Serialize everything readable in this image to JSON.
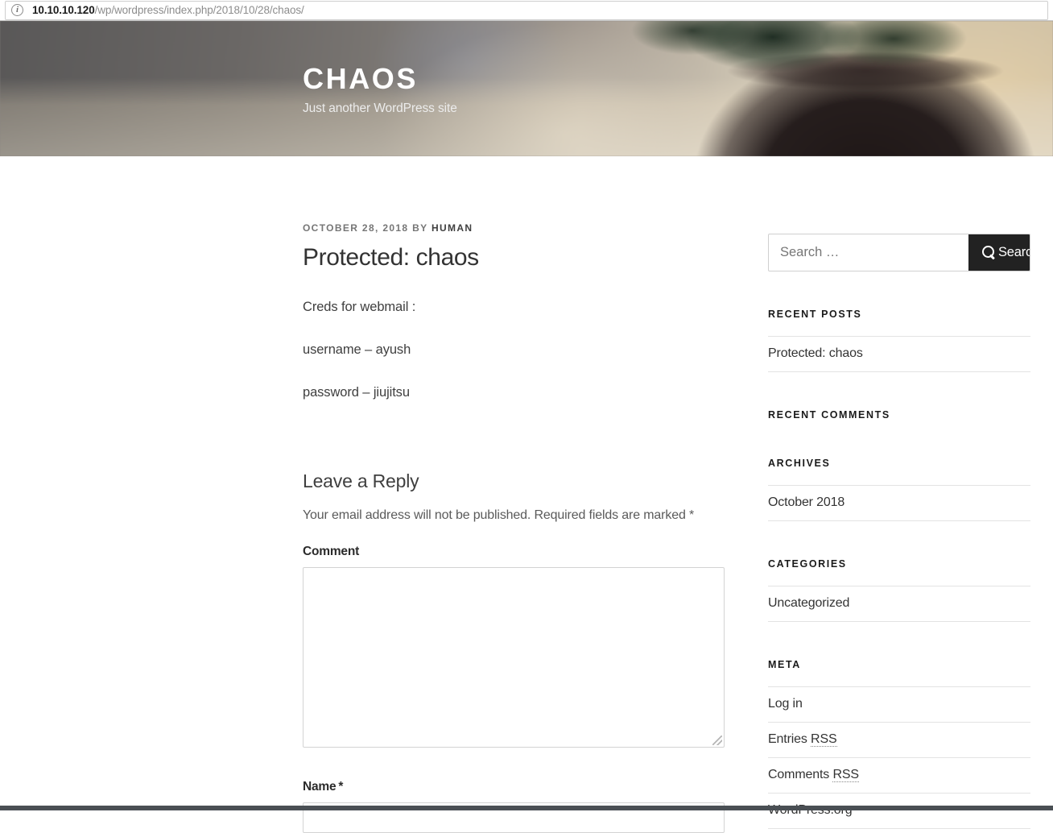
{
  "browser": {
    "info_icon": "info-circle-icon",
    "url_host": "10.10.10.120",
    "url_path": "/wp/wordpress/index.php/2018/10/28/chaos/"
  },
  "header": {
    "site_title": "CHAOS",
    "tagline": "Just another WordPress site"
  },
  "post": {
    "meta_date": "OCTOBER 28, 2018",
    "meta_by": "BY",
    "meta_author": "HUMAN",
    "title": "Protected: chaos",
    "paragraphs": [
      "Creds for webmail :",
      "username – ayush",
      "password – jiujitsu"
    ]
  },
  "comments": {
    "title": "Leave a Reply",
    "notes": "Your email address will not be published. Required fields are marked *",
    "comment_label": "Comment",
    "comment_value": "",
    "name_label": "Name",
    "name_required_mark": "*",
    "name_value": ""
  },
  "sidebar": {
    "search": {
      "placeholder": "Search …",
      "value": "",
      "button_label": "Search",
      "button_icon": "magnifier-icon",
      "button_bg": "#222222"
    },
    "widgets": [
      {
        "title": "Recent Posts",
        "items": [
          "Protected: chaos"
        ]
      },
      {
        "title": "Recent Comments",
        "items": []
      },
      {
        "title": "Archives",
        "items": [
          "October 2018"
        ]
      },
      {
        "title": "Categories",
        "items": [
          "Uncategorized"
        ]
      },
      {
        "title": "Meta",
        "items": [
          "Log in",
          "Entries RSS",
          "Comments RSS",
          "WordPress.org"
        ]
      }
    ]
  },
  "colors": {
    "accent_dark": "#222222",
    "text": "#333333",
    "muted": "#767676",
    "rule": "#e3e3e3"
  }
}
